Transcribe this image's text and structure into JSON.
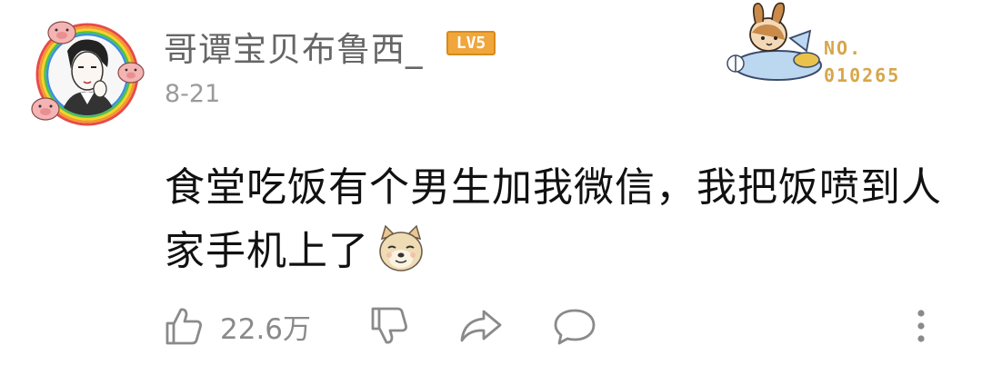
{
  "post": {
    "username": "哥谭宝贝布鲁西_",
    "level_badge": "LV5",
    "date": "8-21",
    "fan_badge": {
      "line1": "NO.",
      "line2": "010265"
    },
    "comment_text": "食堂吃饭有个男生加我微信，我把饭喷到人家手机上了",
    "emoji": "doge-icon"
  },
  "actions": {
    "like_count": "22.6万",
    "like_icon": "thumbs-up-icon",
    "dislike_icon": "thumbs-down-icon",
    "share_icon": "share-icon",
    "comment_icon": "comment-bubble-icon",
    "more_icon": "more-vertical-icon"
  },
  "colors": {
    "username": "#666666",
    "date": "#9a9a9a",
    "level_badge": "#f0a63a",
    "fan_number": "#d7a64a",
    "icon_gray": "#8a8a8a"
  }
}
